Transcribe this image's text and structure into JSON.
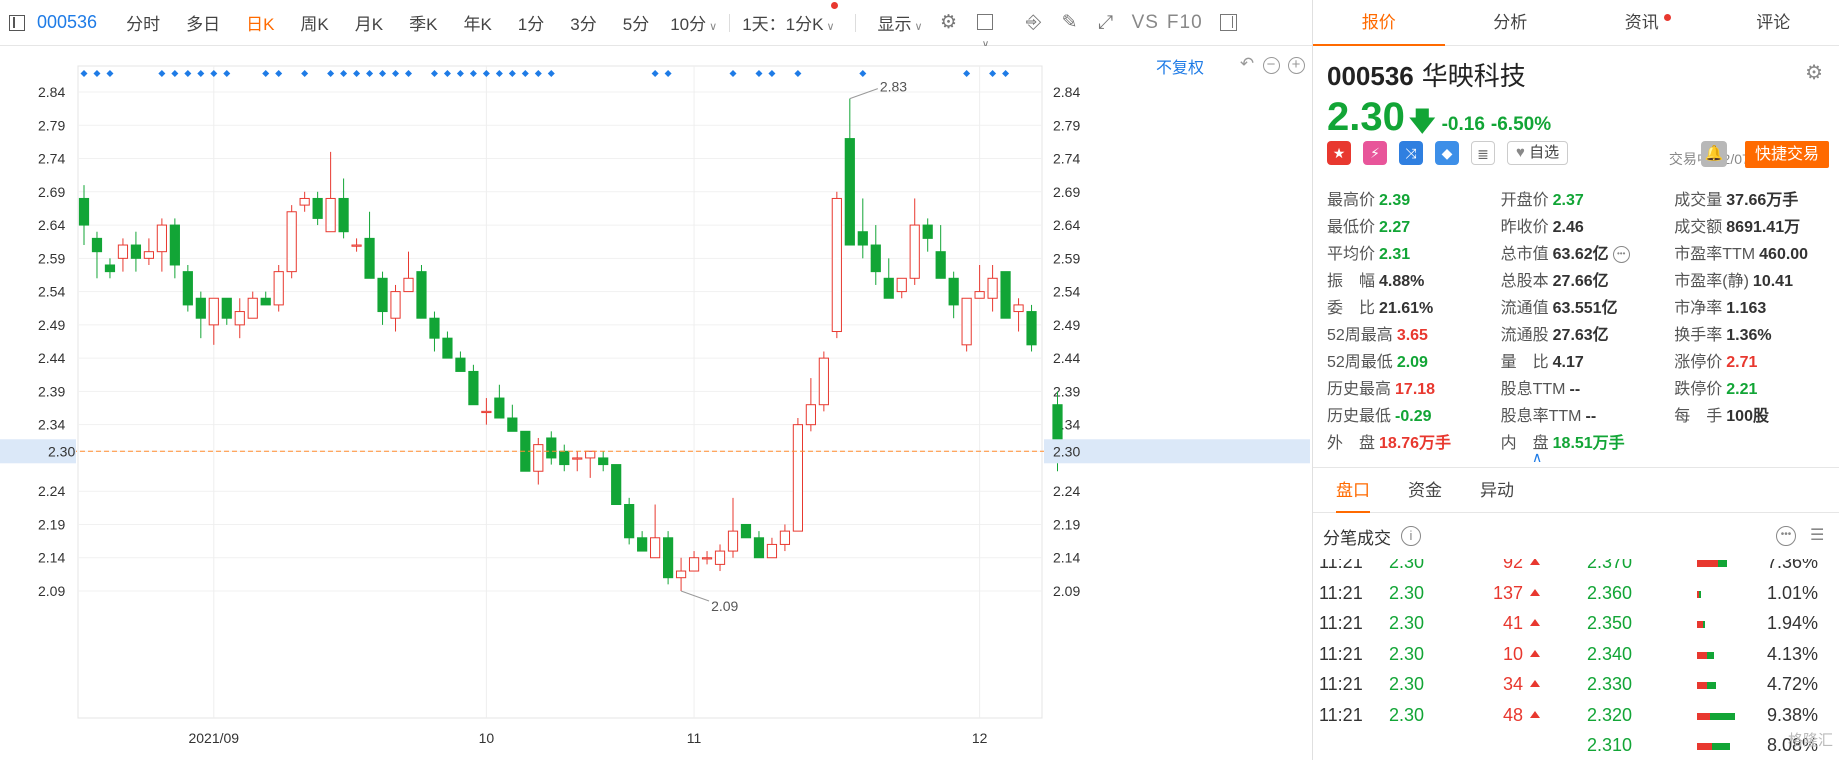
{
  "toolbar": {
    "code": "000536",
    "tabs": [
      "分时",
      "多日",
      "日K",
      "周K",
      "月K",
      "季K",
      "年K",
      "1分",
      "3分",
      "5分",
      "10分"
    ],
    "active_tab": "日K",
    "interval_select": "1天：1分K",
    "display_label": "显示",
    "vs_label": "VS",
    "f10_label": "F10",
    "icons": [
      "panel-toggle-icon",
      "gear-icon",
      "checkbox-icon",
      "camera-icon",
      "pencil-icon",
      "fullscreen-icon",
      "sidebar-icon"
    ]
  },
  "chart": {
    "adjust_label": "不复权",
    "controls": [
      "undo-icon",
      "zoom-out-icon",
      "zoom-in-icon"
    ],
    "y_ticks": [
      "2.84",
      "2.79",
      "2.74",
      "2.69",
      "2.64",
      "2.59",
      "2.54",
      "2.49",
      "2.44",
      "2.39",
      "2.34",
      "2.30",
      "2.24",
      "2.19",
      "2.14",
      "2.09"
    ],
    "x_labels": [
      "2021/09",
      "10",
      "11",
      "12"
    ],
    "crosshair_label": "2.30",
    "high_label": "2.83",
    "low_label": "2.09"
  },
  "chart_data": {
    "type": "candlestick",
    "ylim": [
      2.04,
      2.88
    ],
    "crosshair_value": 2.3,
    "up_color": "#e8382f",
    "down_color": "#12a536",
    "candles": [
      {
        "o": 2.68,
        "h": 2.7,
        "l": 2.61,
        "c": 2.64
      },
      {
        "o": 2.62,
        "h": 2.63,
        "l": 2.56,
        "c": 2.6
      },
      {
        "o": 2.58,
        "h": 2.59,
        "l": 2.56,
        "c": 2.57
      },
      {
        "o": 2.59,
        "h": 2.62,
        "l": 2.57,
        "c": 2.61
      },
      {
        "o": 2.61,
        "h": 2.63,
        "l": 2.57,
        "c": 2.59
      },
      {
        "o": 2.59,
        "h": 2.62,
        "l": 2.58,
        "c": 2.6
      },
      {
        "o": 2.6,
        "h": 2.65,
        "l": 2.57,
        "c": 2.64
      },
      {
        "o": 2.64,
        "h": 2.65,
        "l": 2.56,
        "c": 2.58
      },
      {
        "o": 2.57,
        "h": 2.58,
        "l": 2.51,
        "c": 2.52
      },
      {
        "o": 2.53,
        "h": 2.54,
        "l": 2.47,
        "c": 2.5
      },
      {
        "o": 2.49,
        "h": 2.53,
        "l": 2.46,
        "c": 2.53
      },
      {
        "o": 2.53,
        "h": 2.53,
        "l": 2.49,
        "c": 2.5
      },
      {
        "o": 2.49,
        "h": 2.53,
        "l": 2.47,
        "c": 2.51
      },
      {
        "o": 2.5,
        "h": 2.54,
        "l": 2.5,
        "c": 2.53
      },
      {
        "o": 2.53,
        "h": 2.54,
        "l": 2.52,
        "c": 2.52
      },
      {
        "o": 2.52,
        "h": 2.58,
        "l": 2.51,
        "c": 2.57
      },
      {
        "o": 2.57,
        "h": 2.67,
        "l": 2.56,
        "c": 2.66
      },
      {
        "o": 2.67,
        "h": 2.69,
        "l": 2.66,
        "c": 2.68
      },
      {
        "o": 2.68,
        "h": 2.69,
        "l": 2.64,
        "c": 2.65
      },
      {
        "o": 2.63,
        "h": 2.75,
        "l": 2.63,
        "c": 2.68
      },
      {
        "o": 2.68,
        "h": 2.71,
        "l": 2.62,
        "c": 2.63
      },
      {
        "o": 2.61,
        "h": 2.62,
        "l": 2.6,
        "c": 2.61
      },
      {
        "o": 2.62,
        "h": 2.66,
        "l": 2.56,
        "c": 2.56
      },
      {
        "o": 2.56,
        "h": 2.57,
        "l": 2.49,
        "c": 2.51
      },
      {
        "o": 2.5,
        "h": 2.55,
        "l": 2.48,
        "c": 2.54
      },
      {
        "o": 2.54,
        "h": 2.6,
        "l": 2.54,
        "c": 2.56
      },
      {
        "o": 2.57,
        "h": 2.58,
        "l": 2.5,
        "c": 2.5
      },
      {
        "o": 2.5,
        "h": 2.51,
        "l": 2.45,
        "c": 2.47
      },
      {
        "o": 2.47,
        "h": 2.48,
        "l": 2.44,
        "c": 2.44
      },
      {
        "o": 2.44,
        "h": 2.45,
        "l": 2.42,
        "c": 2.42
      },
      {
        "o": 2.42,
        "h": 2.43,
        "l": 2.37,
        "c": 2.37
      },
      {
        "o": 2.36,
        "h": 2.38,
        "l": 2.34,
        "c": 2.36
      },
      {
        "o": 2.38,
        "h": 2.4,
        "l": 2.35,
        "c": 2.35
      },
      {
        "o": 2.35,
        "h": 2.37,
        "l": 2.33,
        "c": 2.33
      },
      {
        "o": 2.33,
        "h": 2.33,
        "l": 2.27,
        "c": 2.27
      },
      {
        "o": 2.27,
        "h": 2.32,
        "l": 2.25,
        "c": 2.31
      },
      {
        "o": 2.32,
        "h": 2.33,
        "l": 2.28,
        "c": 2.29
      },
      {
        "o": 2.3,
        "h": 2.31,
        "l": 2.27,
        "c": 2.28
      },
      {
        "o": 2.29,
        "h": 2.3,
        "l": 2.27,
        "c": 2.29
      },
      {
        "o": 2.29,
        "h": 2.3,
        "l": 2.26,
        "c": 2.3
      },
      {
        "o": 2.29,
        "h": 2.3,
        "l": 2.27,
        "c": 2.28
      },
      {
        "o": 2.28,
        "h": 2.28,
        "l": 2.22,
        "c": 2.22
      },
      {
        "o": 2.22,
        "h": 2.23,
        "l": 2.16,
        "c": 2.17
      },
      {
        "o": 2.17,
        "h": 2.18,
        "l": 2.15,
        "c": 2.15
      },
      {
        "o": 2.14,
        "h": 2.22,
        "l": 2.14,
        "c": 2.17
      },
      {
        "o": 2.17,
        "h": 2.18,
        "l": 2.1,
        "c": 2.11
      },
      {
        "o": 2.11,
        "h": 2.14,
        "l": 2.09,
        "c": 2.12
      },
      {
        "o": 2.12,
        "h": 2.15,
        "l": 2.12,
        "c": 2.14
      },
      {
        "o": 2.14,
        "h": 2.15,
        "l": 2.13,
        "c": 2.14
      },
      {
        "o": 2.13,
        "h": 2.16,
        "l": 2.12,
        "c": 2.15
      },
      {
        "o": 2.15,
        "h": 2.23,
        "l": 2.14,
        "c": 2.18
      },
      {
        "o": 2.19,
        "h": 2.19,
        "l": 2.17,
        "c": 2.17
      },
      {
        "o": 2.17,
        "h": 2.18,
        "l": 2.14,
        "c": 2.14
      },
      {
        "o": 2.14,
        "h": 2.17,
        "l": 2.14,
        "c": 2.16
      },
      {
        "o": 2.16,
        "h": 2.19,
        "l": 2.15,
        "c": 2.18
      },
      {
        "o": 2.18,
        "h": 2.35,
        "l": 2.18,
        "c": 2.34
      },
      {
        "o": 2.34,
        "h": 2.41,
        "l": 2.33,
        "c": 2.37
      },
      {
        "o": 2.37,
        "h": 2.45,
        "l": 2.36,
        "c": 2.44
      },
      {
        "o": 2.48,
        "h": 2.69,
        "l": 2.47,
        "c": 2.68
      },
      {
        "o": 2.77,
        "h": 2.83,
        "l": 2.61,
        "c": 2.61
      },
      {
        "o": 2.63,
        "h": 2.68,
        "l": 2.59,
        "c": 2.61
      },
      {
        "o": 2.61,
        "h": 2.64,
        "l": 2.55,
        "c": 2.57
      },
      {
        "o": 2.56,
        "h": 2.59,
        "l": 2.53,
        "c": 2.53
      },
      {
        "o": 2.54,
        "h": 2.56,
        "l": 2.53,
        "c": 2.56
      },
      {
        "o": 2.56,
        "h": 2.68,
        "l": 2.55,
        "c": 2.64
      },
      {
        "o": 2.64,
        "h": 2.65,
        "l": 2.6,
        "c": 2.62
      },
      {
        "o": 2.6,
        "h": 2.64,
        "l": 2.56,
        "c": 2.56
      },
      {
        "o": 2.56,
        "h": 2.57,
        "l": 2.5,
        "c": 2.52
      },
      {
        "o": 2.46,
        "h": 2.53,
        "l": 2.45,
        "c": 2.53
      },
      {
        "o": 2.53,
        "h": 2.58,
        "l": 2.53,
        "c": 2.54
      },
      {
        "o": 2.53,
        "h": 2.58,
        "l": 2.51,
        "c": 2.56
      },
      {
        "o": 2.57,
        "h": 2.57,
        "l": 2.5,
        "c": 2.5
      },
      {
        "o": 2.51,
        "h": 2.53,
        "l": 2.48,
        "c": 2.52
      },
      {
        "o": 2.51,
        "h": 2.52,
        "l": 2.45,
        "c": 2.46
      },
      null,
      {
        "o": 2.37,
        "h": 2.39,
        "l": 2.27,
        "c": 2.3
      }
    ]
  },
  "panel": {
    "tabs": [
      "报价",
      "分析",
      "资讯",
      "评论"
    ],
    "active_tab": "报价",
    "code": "000536",
    "name": "华映科技",
    "price": "2.30",
    "change": "-0.16",
    "change_pct": "-6.50%",
    "status": "交易中 12/07 11:21(北京)",
    "fav_label": "自选",
    "trade_button": "快捷交易",
    "stats": [
      [
        {
          "label": "最高价",
          "value": "2.39",
          "color": "green"
        },
        {
          "label": "开盘价",
          "value": "2.37",
          "color": "green"
        },
        {
          "label": "成交量",
          "value": "37.66万手",
          "color": ""
        }
      ],
      [
        {
          "label": "最低价",
          "value": "2.27",
          "color": "green"
        },
        {
          "label": "昨收价",
          "value": "2.46",
          "color": ""
        },
        {
          "label": "成交额",
          "value": "8691.41万",
          "color": ""
        }
      ],
      [
        {
          "label": "平均价",
          "value": "2.31",
          "color": "green"
        },
        {
          "label": "总市值",
          "value": "63.62亿",
          "color": ""
        },
        {
          "label": "市盈率TTM",
          "value": "460.00",
          "color": ""
        }
      ],
      [
        {
          "label": "振　幅",
          "value": "4.88%",
          "color": ""
        },
        {
          "label": "总股本",
          "value": "27.66亿",
          "color": ""
        },
        {
          "label": "市盈率(静)",
          "value": "10.41",
          "color": ""
        }
      ],
      [
        {
          "label": "委　比",
          "value": "21.61%",
          "color": ""
        },
        {
          "label": "流通值",
          "value": "63.551亿",
          "color": ""
        },
        {
          "label": "市净率",
          "value": "1.163",
          "color": ""
        }
      ],
      [
        {
          "label": "52周最高",
          "value": "3.65",
          "color": "red"
        },
        {
          "label": "流通股",
          "value": "27.63亿",
          "color": ""
        },
        {
          "label": "换手率",
          "value": "1.36%",
          "color": ""
        }
      ],
      [
        {
          "label": "52周最低",
          "value": "2.09",
          "color": "green"
        },
        {
          "label": "量　比",
          "value": "4.17",
          "color": ""
        },
        {
          "label": "涨停价",
          "value": "2.71",
          "color": "red"
        }
      ],
      [
        {
          "label": "历史最高",
          "value": "17.18",
          "color": "red"
        },
        {
          "label": "股息TTM",
          "value": "--",
          "color": ""
        },
        {
          "label": "跌停价",
          "value": "2.21",
          "color": "green"
        }
      ],
      [
        {
          "label": "历史最低",
          "value": "-0.29",
          "color": "green"
        },
        {
          "label": "股息率TTM",
          "value": "--",
          "color": ""
        },
        {
          "label": "每　手",
          "value": "100股",
          "color": ""
        }
      ],
      [
        {
          "label": "外　盘",
          "value": "18.76万手",
          "color": "red"
        },
        {
          "label": "内　盘",
          "value": "18.51万手",
          "color": "green"
        },
        {
          "label": "",
          "value": "",
          "color": ""
        }
      ]
    ],
    "sub_tabs": [
      "盘口",
      "资金",
      "异动"
    ],
    "active_sub_tab": "盘口",
    "ticks_title": "分笔成交",
    "ticks": [
      {
        "time": "11:21",
        "price": "2.30",
        "vol": "92"
      },
      {
        "time": "11:21",
        "price": "2.30",
        "vol": "137"
      },
      {
        "time": "11:21",
        "price": "2.30",
        "vol": "41"
      },
      {
        "time": "11:21",
        "price": "2.30",
        "vol": "10"
      },
      {
        "time": "11:21",
        "price": "2.30",
        "vol": "34"
      },
      {
        "time": "11:21",
        "price": "2.30",
        "vol": "48"
      }
    ],
    "levels": [
      {
        "price": "2.370",
        "pct": "7.36%",
        "pct_value": 7.36,
        "red_share": 0.72
      },
      {
        "price": "2.360",
        "pct": "1.01%",
        "pct_value": 1.01,
        "red_share": 0.5
      },
      {
        "price": "2.350",
        "pct": "1.94%",
        "pct_value": 1.94,
        "red_share": 0.8
      },
      {
        "price": "2.340",
        "pct": "4.13%",
        "pct_value": 4.13,
        "red_share": 0.6
      },
      {
        "price": "2.330",
        "pct": "4.72%",
        "pct_value": 4.72,
        "red_share": 0.5
      },
      {
        "price": "2.320",
        "pct": "9.38%",
        "pct_value": 9.38,
        "red_share": 0.35
      },
      {
        "price": "2.310",
        "pct": "8.08%",
        "pct_value": 8.08,
        "red_share": 0.45
      }
    ],
    "watermark": "格隆汇"
  }
}
